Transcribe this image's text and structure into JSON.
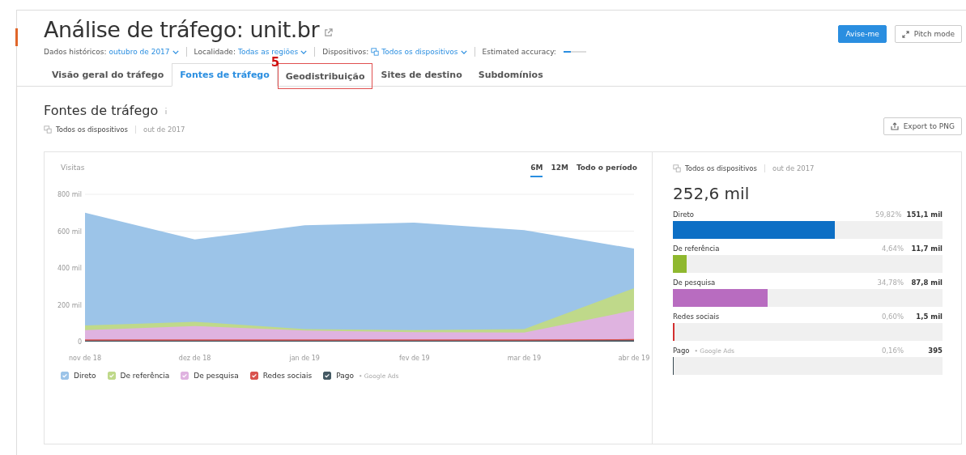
{
  "header": {
    "title": "Análise de tráfego: unit.br",
    "buttons": [
      {
        "label": "Avise-me",
        "kind": "primary"
      },
      {
        "label": "Pitch mode",
        "kind": "secondary"
      }
    ]
  },
  "filters": [
    {
      "label": "Dados históricos:",
      "value": "outubro de 2017",
      "icon": false
    },
    {
      "label": "Localidade:",
      "value": "Todas as regiões",
      "icon": false
    },
    {
      "label": "Dispositivos:",
      "value": "Todos os dispositivos",
      "icon": true
    }
  ],
  "estimated_accuracy": {
    "label": "Estimated accuracy:",
    "level": 0.34
  },
  "tabs": [
    {
      "label": "Visão geral do tráfego",
      "selected": false,
      "highlighted": false
    },
    {
      "label": "Fontes de tráfego",
      "selected": true,
      "highlighted": false
    },
    {
      "label": "Geodistribuição",
      "selected": false,
      "highlighted": true
    },
    {
      "label": "Sites de destino",
      "selected": false,
      "highlighted": false
    },
    {
      "label": "Subdomínios",
      "selected": false,
      "highlighted": false
    }
  ],
  "annotation": {
    "label": "5"
  },
  "section": {
    "title": "Fontes de tráfego",
    "device": "Todos os dispositivos",
    "date": "out de 2017",
    "export_button": "Export to PNG"
  },
  "periods": [
    {
      "label": "6M",
      "selected": true
    },
    {
      "label": "12M",
      "selected": false
    },
    {
      "label": "Todo o período",
      "selected": false
    }
  ],
  "chart_data": {
    "type": "area",
    "stacked": false,
    "ylabel": "Visitas",
    "categories": [
      "nov de 18",
      "dez de 18",
      "jan de 19",
      "fev de 19",
      "mar de 19",
      "abr de 19"
    ],
    "ylim": [
      0,
      800
    ],
    "yticks": [
      {
        "value": 0,
        "label": "0"
      },
      {
        "value": 200,
        "label": "200 mil"
      },
      {
        "value": 400,
        "label": "400 mil"
      },
      {
        "value": 600,
        "label": "600 mil"
      },
      {
        "value": 800,
        "label": "800 mil"
      }
    ],
    "series": [
      {
        "name": "Direto",
        "color": "#9cc4e8",
        "values": [
          700,
          555,
          632,
          646,
          605,
          505
        ]
      },
      {
        "name": "De referência",
        "color": "#bfd98a",
        "values": [
          88,
          108,
          68,
          63,
          68,
          290
        ]
      },
      {
        "name": "De pesquisa",
        "color": "#dfb3e0",
        "values": [
          63,
          85,
          60,
          52,
          50,
          170
        ]
      },
      {
        "name": "Redes sociais",
        "color": "#d9534f",
        "values": [
          12,
          12,
          12,
          12,
          12,
          14
        ]
      },
      {
        "name": "Pago",
        "color": "#455a64",
        "values": [
          5,
          5,
          5,
          5,
          5,
          8
        ]
      }
    ],
    "legend": [
      {
        "checked": true
      },
      {
        "checked": true
      },
      {
        "checked": true
      },
      {
        "checked": true
      },
      {
        "note": "• Google Ads",
        "checked": true
      }
    ]
  },
  "summary": {
    "device": "Todos os dispositivos",
    "date": "out de 2017",
    "total": "252,6 mil",
    "rows": [
      {
        "name": "Direto",
        "percent": "59,82%",
        "value": "151,1 mil",
        "level": 0.6,
        "color": "#0d6fc5"
      },
      {
        "name": "De referência",
        "percent": "4,64%",
        "value": "11,7 mil",
        "level": 0.05,
        "color": "#8fb82f"
      },
      {
        "name": "De pesquisa",
        "percent": "34,78%",
        "value": "87,8 mil",
        "level": 0.35,
        "color": "#b86cc0"
      },
      {
        "name": "Redes sociais",
        "percent": "0,60%",
        "value": "1,5 mil",
        "level": 0.006,
        "color": "#d32f2f"
      },
      {
        "name": "Pago",
        "note": "• Google Ads",
        "percent": "0,16%",
        "value": "395",
        "level": 0.002,
        "color": "#37474f"
      }
    ]
  }
}
